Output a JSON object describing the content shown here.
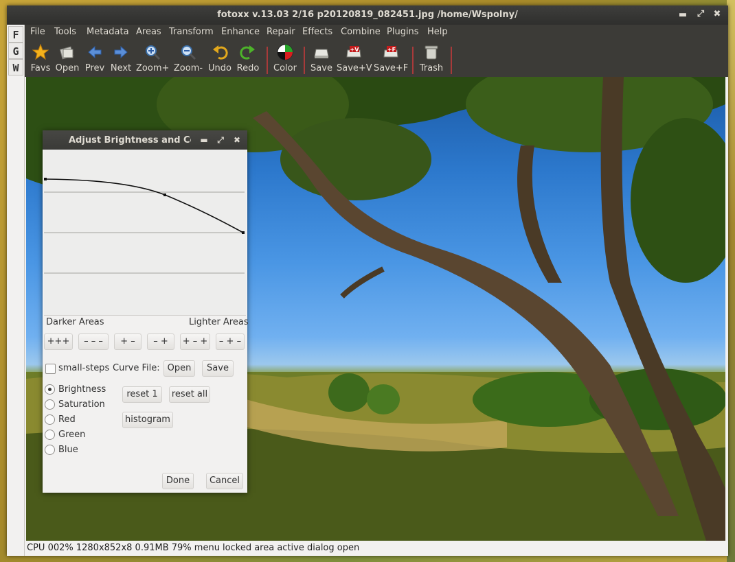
{
  "window": {
    "title": "fotoxx v.13.03  2/16  p20120819_082451.jpg  /home/Wspolny/"
  },
  "mode_buttons": [
    "F",
    "G",
    "W"
  ],
  "menu": [
    "File",
    "Tools",
    "Metadata",
    "Areas",
    "Transform",
    "Enhance",
    "Repair",
    "Effects",
    "Combine",
    "Plugins",
    "Help"
  ],
  "toolbar": [
    {
      "label": "Favs",
      "icon": "star-icon"
    },
    {
      "label": "Open",
      "icon": "open-icon"
    },
    {
      "label": "Prev",
      "icon": "arrow-left-icon"
    },
    {
      "label": "Next",
      "icon": "arrow-right-icon"
    },
    {
      "label": "Zoom+",
      "icon": "zoom-in-icon"
    },
    {
      "label": "Zoom-",
      "icon": "zoom-out-icon"
    },
    {
      "label": "Undo",
      "icon": "undo-icon"
    },
    {
      "label": "Redo",
      "icon": "redo-icon"
    },
    {
      "label": "Color",
      "icon": "color-wheel-icon"
    },
    {
      "label": "Save",
      "icon": "save-icon"
    },
    {
      "label": "Save+V",
      "icon": "save-version-icon",
      "badge": "+V"
    },
    {
      "label": "Save+F",
      "icon": "save-file-icon",
      "badge": "+F"
    },
    {
      "label": "Trash",
      "icon": "trash-icon"
    }
  ],
  "status": "CPU 002%  1280x852x8  0.91MB  79%  menu locked  area active  dialog open",
  "dialog": {
    "title": "Adjust Brightness and Color",
    "darker_label": "Darker Areas",
    "lighter_label": "Lighter Areas",
    "adjust_buttons": [
      "+++",
      "– – –",
      "+ –",
      "– +",
      "+ – +",
      "– + –"
    ],
    "small_steps_label": "small-steps",
    "small_steps_checked": false,
    "curve_file_label": "Curve File:",
    "curve_open": "Open",
    "curve_save": "Save",
    "channels": [
      "Brightness",
      "Saturation",
      "Red",
      "Green",
      "Blue"
    ],
    "selected_channel": "Brightness",
    "reset1": "reset 1",
    "reset_all": "reset all",
    "histogram": "histogram",
    "done": "Done",
    "cancel": "Cancel"
  }
}
